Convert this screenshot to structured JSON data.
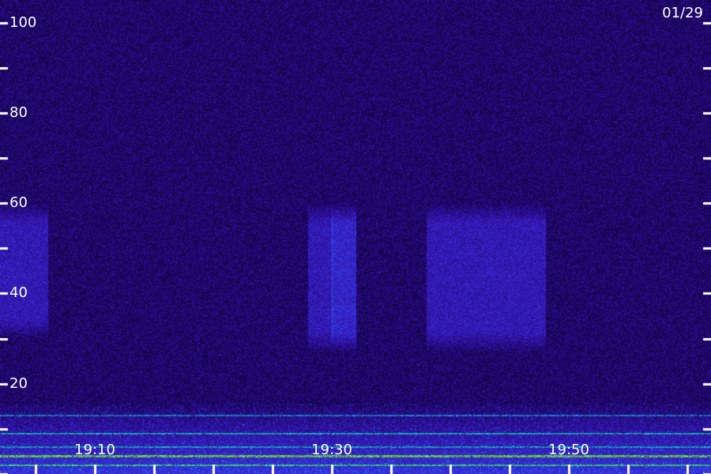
{
  "date_label": "01/29",
  "chart_data": {
    "type": "heatmap",
    "y_ticks": [
      20,
      40,
      60,
      80,
      100
    ],
    "y_ticks_minor": [
      0,
      10,
      30,
      50,
      70,
      90
    ],
    "ylim": [
      0,
      105
    ],
    "x_ticks": [
      "19:10",
      "19:30",
      "19:50"
    ],
    "xlim": [
      "19:02",
      "20:02"
    ],
    "x_minor_ticks": [
      "19:05",
      "19:10",
      "19:15",
      "19:20",
      "19:25",
      "19:30",
      "19:35",
      "19:40",
      "19:45",
      "19:50",
      "19:55",
      "20:00"
    ],
    "colormap": [
      "#05001a",
      "#2a0a8c",
      "#3a2ad8",
      "#1f6dff",
      "#19d2e8",
      "#3dff8a"
    ],
    "background_level": "dark purple noise",
    "bands": [
      {
        "x": [
          "19:02",
          "19:06"
        ],
        "y": [
          30,
          60
        ],
        "intensity": "medium"
      },
      {
        "x": [
          "19:28",
          "19:30"
        ],
        "y": [
          27,
          60
        ],
        "intensity": "medium"
      },
      {
        "x": [
          "19:30",
          "19:32"
        ],
        "y": [
          27,
          60
        ],
        "intensity": "medium-high"
      },
      {
        "x": [
          "19:38",
          "19:48"
        ],
        "y": [
          27,
          60
        ],
        "intensity": "medium"
      }
    ],
    "emission_lines": [
      {
        "y": 2,
        "color": "#3dff8a"
      },
      {
        "y": 4,
        "color": "#7dff5a"
      },
      {
        "y": 6,
        "color": "#19d2e8"
      },
      {
        "y": 9,
        "color": "#19d2e8"
      },
      {
        "y": 13,
        "color": "#1f9dff"
      }
    ],
    "xlabel": "",
    "ylabel": ""
  }
}
